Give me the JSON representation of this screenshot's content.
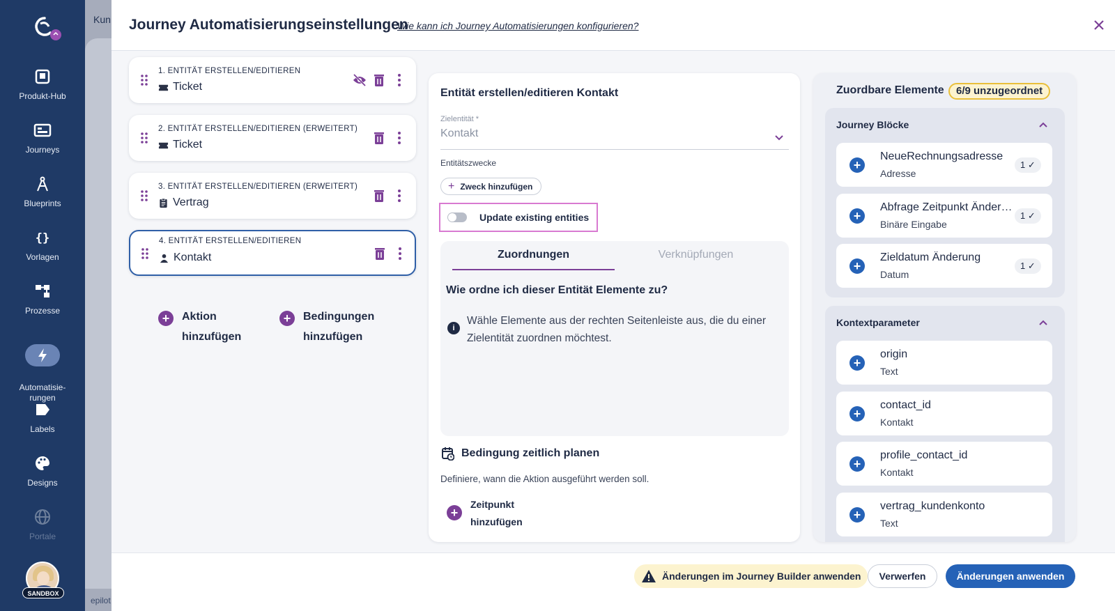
{
  "background": {
    "breadcrumb_fragment": "Kun",
    "footer_fragment": "epilot"
  },
  "nav": {
    "items": [
      {
        "label": "Produkt-Hub",
        "icon": "product-hub-icon"
      },
      {
        "label": "Journeys",
        "icon": "journeys-icon"
      },
      {
        "label": "Blueprints",
        "icon": "blueprints-icon"
      },
      {
        "label": "Vorlagen",
        "icon": "templates-icon"
      },
      {
        "label": "Prozesse",
        "icon": "processes-icon"
      },
      {
        "label": "Automatisie-\nrungen",
        "icon": "lightning-icon",
        "active": true
      },
      {
        "label": "Labels",
        "icon": "label-icon"
      },
      {
        "label": "Designs",
        "icon": "palette-icon"
      },
      {
        "label": "Portale",
        "icon": "globe-icon"
      }
    ],
    "sandbox_label": "SANDBOX"
  },
  "modal": {
    "title": "Journey Automatisierungseinstellungen",
    "help_link": "Wie kann ich Journey Automatisierungen konfigurieren?"
  },
  "actions": [
    {
      "step": "1. ENTITÄT ERSTELLEN/EDITIEREN",
      "entity": "Ticket",
      "hidden_icon": true
    },
    {
      "step": "2. ENTITÄT ERSTELLEN/EDITIEREN (ERWEITERT)",
      "entity": "Ticket"
    },
    {
      "step": "3. ENTITÄT ERSTELLEN/EDITIEREN (ERWEITERT)",
      "entity": "Vertrag"
    },
    {
      "step": "4. ENTITÄT ERSTELLEN/EDITIEREN",
      "entity": "Kontakt",
      "selected": true
    }
  ],
  "add_action_label": "Aktion hinzufügen",
  "add_condition_label": "Bedingungen hinzufügen",
  "center": {
    "title": "Entität erstellen/editieren Kontakt",
    "target_label": "Zielentität *",
    "target_value": "Kontakt",
    "purposes_label": "Entitätszwecke",
    "add_purpose": "Zweck hinzufügen",
    "update_existing": "Update existing entities",
    "tabs": [
      "Zuordnungen",
      "Verknüpfungen"
    ],
    "assign_question": "Wie ordne ich dieser Entität Elemente zu?",
    "assign_info": "Wähle Elemente aus der rechten Seitenleiste aus, die du einer Zielentität zuordnen möchtest.",
    "schedule_title": "Bedingung zeitlich planen",
    "schedule_desc": "Definiere, wann die Aktion ausgeführt werden soll.",
    "add_time": "Zeitpunkt hinzufügen"
  },
  "right": {
    "title": "Zuordbare Elemente",
    "badge": "6/9 unzugeordnet",
    "group1": {
      "title": "Journey Blöcke",
      "items": [
        {
          "name": "NeueRechnungsadresse",
          "type": "Adresse",
          "count": "1"
        },
        {
          "name": "Abfrage Zeitpunkt Änderung",
          "type": "Binäre Eingabe",
          "count": "1"
        },
        {
          "name": "Zieldatum Änderung",
          "type": "Datum",
          "count": "1"
        }
      ]
    },
    "group2": {
      "title": "Kontextparameter",
      "items": [
        {
          "name": "origin",
          "type": "Text"
        },
        {
          "name": "contact_id",
          "type": "Kontakt"
        },
        {
          "name": "profile_contact_id",
          "type": "Kontakt"
        },
        {
          "name": "vertrag_kundenkonto",
          "type": "Text"
        }
      ]
    }
  },
  "footer": {
    "warning": "Änderungen im Journey Builder anwenden",
    "discard": "Verwerfen",
    "apply": "Änderungen anwenden"
  },
  "colors": {
    "nav_bg": "#1f3a66",
    "accent_purple": "#7b3f97",
    "primary_blue": "#2562b7",
    "warning_bg": "#fcf3cf",
    "highlight_pink": "#d87ad1"
  }
}
